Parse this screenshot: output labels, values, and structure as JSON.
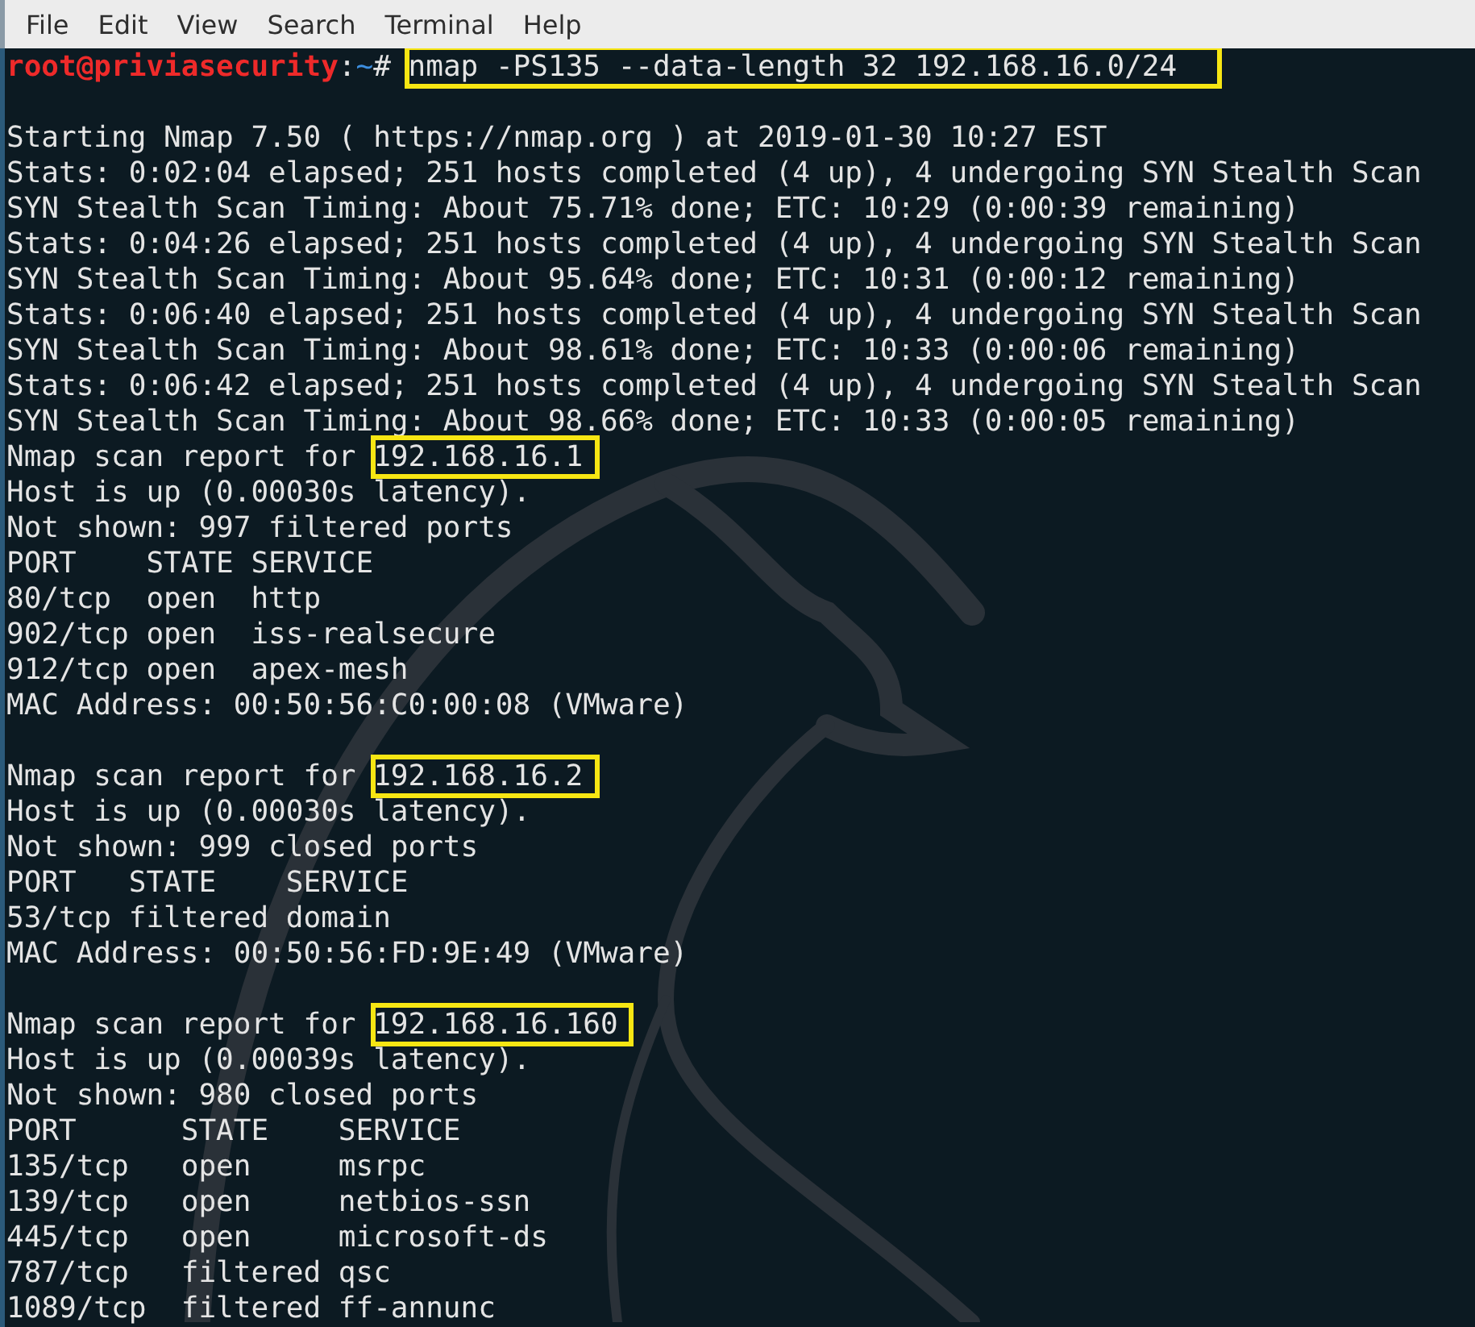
{
  "menu": [
    "File",
    "Edit",
    "View",
    "Search",
    "Terminal",
    "Help"
  ],
  "lines": [
    {
      "kind": "prompt",
      "prompt": [
        {
          "kind": "user",
          "text": "root@priviasecurity"
        },
        {
          "kind": "sep",
          "text": ":"
        },
        {
          "kind": "path",
          "text": "~"
        },
        {
          "kind": "sep",
          "text": "# "
        }
      ],
      "command": "nmap -PS135 --data-length 32 192.168.16.0/24"
    },
    {
      "kind": "blank"
    },
    {
      "kind": "output",
      "text": "Starting Nmap 7.50 ( https://nmap.org ) at 2019-01-30 10:27 EST"
    },
    {
      "kind": "output",
      "text": "Stats: 0:02:04 elapsed; 251 hosts completed (4 up), 4 undergoing SYN Stealth Scan"
    },
    {
      "kind": "output",
      "text": "SYN Stealth Scan Timing: About 75.71% done; ETC: 10:29 (0:00:39 remaining)"
    },
    {
      "kind": "output",
      "text": "Stats: 0:04:26 elapsed; 251 hosts completed (4 up), 4 undergoing SYN Stealth Scan"
    },
    {
      "kind": "output",
      "text": "SYN Stealth Scan Timing: About 95.64% done; ETC: 10:31 (0:00:12 remaining)"
    },
    {
      "kind": "output",
      "text": "Stats: 0:06:40 elapsed; 251 hosts completed (4 up), 4 undergoing SYN Stealth Scan"
    },
    {
      "kind": "output",
      "text": "SYN Stealth Scan Timing: About 98.61% done; ETC: 10:33 (0:00:06 remaining)"
    },
    {
      "kind": "output",
      "text": "Stats: 0:06:42 elapsed; 251 hosts completed (4 up), 4 undergoing SYN Stealth Scan"
    },
    {
      "kind": "output",
      "text": "SYN Stealth Scan Timing: About 98.66% done; ETC: 10:33 (0:00:05 remaining)"
    },
    {
      "kind": "report",
      "text": "Nmap scan report for ",
      "highlight": "192.168.16.1"
    },
    {
      "kind": "output",
      "text": "Host is up (0.00030s latency)."
    },
    {
      "kind": "output",
      "text": "Not shown: 997 filtered ports"
    },
    {
      "kind": "output",
      "text": "PORT    STATE SERVICE"
    },
    {
      "kind": "output",
      "text": "80/tcp  open  http"
    },
    {
      "kind": "output",
      "text": "902/tcp open  iss-realsecure"
    },
    {
      "kind": "output",
      "text": "912/tcp open  apex-mesh"
    },
    {
      "kind": "output",
      "text": "MAC Address: 00:50:56:C0:00:08 (VMware)"
    },
    {
      "kind": "blank"
    },
    {
      "kind": "report",
      "text": "Nmap scan report for ",
      "highlight": "192.168.16.2"
    },
    {
      "kind": "output",
      "text": "Host is up (0.00030s latency)."
    },
    {
      "kind": "output",
      "text": "Not shown: 999 closed ports"
    },
    {
      "kind": "output",
      "text": "PORT   STATE    SERVICE"
    },
    {
      "kind": "output",
      "text": "53/tcp filtered domain"
    },
    {
      "kind": "output",
      "text": "MAC Address: 00:50:56:FD:9E:49 (VMware)"
    },
    {
      "kind": "blank"
    },
    {
      "kind": "report",
      "text": "Nmap scan report for ",
      "highlight": "192.168.16.160"
    },
    {
      "kind": "output",
      "text": "Host is up (0.00039s latency)."
    },
    {
      "kind": "output",
      "text": "Not shown: 980 closed ports"
    },
    {
      "kind": "output",
      "text": "PORT      STATE    SERVICE"
    },
    {
      "kind": "output",
      "text": "135/tcp   open     msrpc"
    },
    {
      "kind": "output",
      "text": "139/tcp   open     netbios-ssn"
    },
    {
      "kind": "output",
      "text": "445/tcp   open     microsoft-ds"
    },
    {
      "kind": "output",
      "text": "787/tcp   filtered qsc"
    },
    {
      "kind": "output",
      "text": "1089/tcp  filtered ff-annunc"
    }
  ]
}
